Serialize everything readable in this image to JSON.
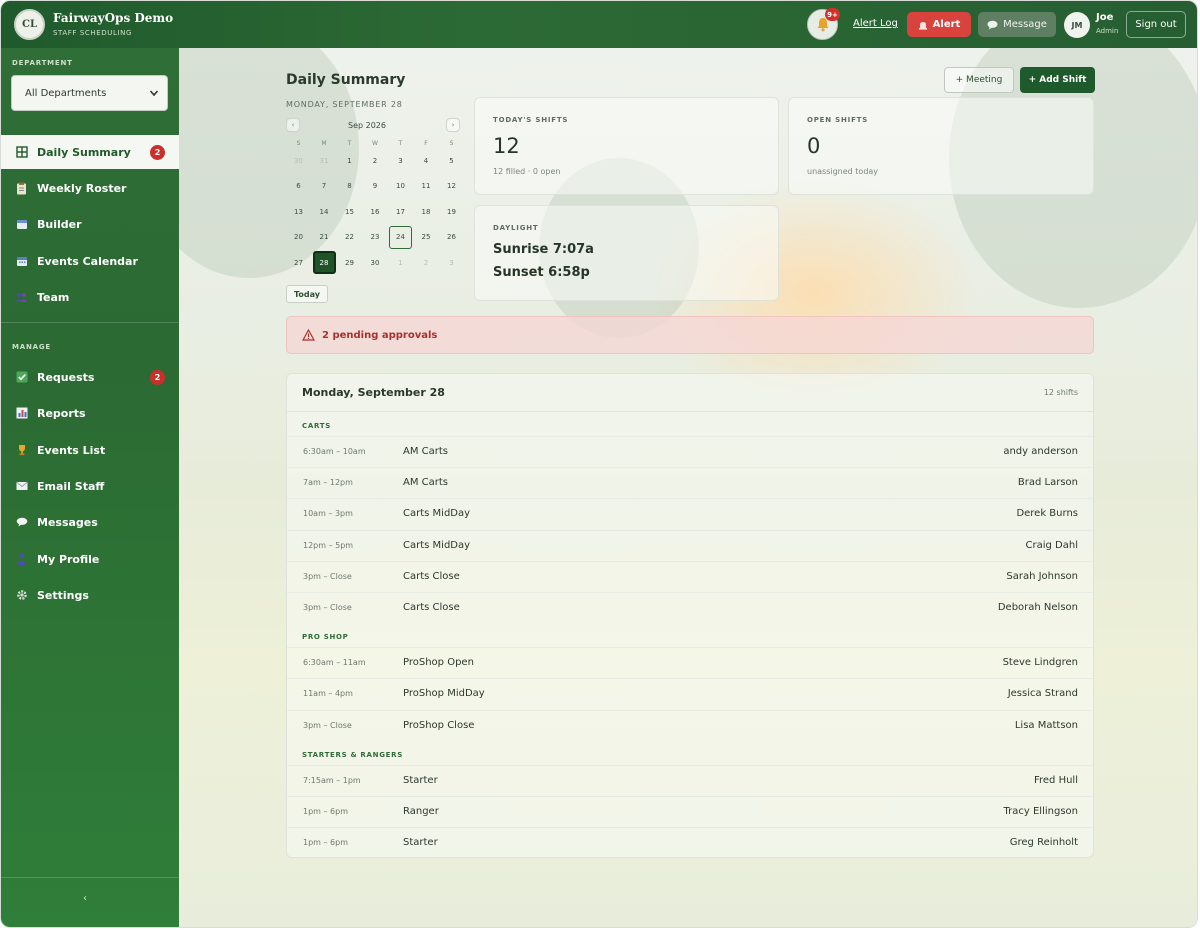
{
  "header": {
    "logo_initials": "CL",
    "app_name": "FairwayOps Demo",
    "app_subtitle": "STAFF SCHEDULING",
    "notification_count": "9+",
    "alert_log_label": "Alert Log",
    "alert_label": "Alert",
    "message_label": "Message",
    "user_initials": "JM",
    "user_name": "Joe",
    "user_role": "Admin",
    "sign_out_label": "Sign out"
  },
  "sidebar": {
    "department_label": "DEPARTMENT",
    "department_value": "All Departments",
    "nav": [
      {
        "label": "Daily Summary",
        "icon": "grid-icon",
        "badge": "2",
        "active": true
      },
      {
        "label": "Weekly Roster",
        "icon": "clipboard-icon"
      },
      {
        "label": "Builder",
        "icon": "calendar-icon"
      },
      {
        "label": "Events Calendar",
        "icon": "calendar-grid-icon"
      },
      {
        "label": "Team",
        "icon": "people-icon"
      }
    ],
    "manage_label": "MANAGE",
    "manage": [
      {
        "label": "Requests",
        "icon": "checkbox-icon",
        "badge": "2"
      },
      {
        "label": "Reports",
        "icon": "bar-chart-icon"
      },
      {
        "label": "Events List",
        "icon": "trophy-icon"
      },
      {
        "label": "Email Staff",
        "icon": "envelope-icon"
      },
      {
        "label": "Messages",
        "icon": "speech-bubble-icon"
      },
      {
        "label": "My Profile",
        "icon": "person-icon"
      },
      {
        "label": "Settings",
        "icon": "gear-icon"
      }
    ],
    "collapse_glyph": "‹"
  },
  "main": {
    "title": "Daily Summary",
    "date_heading": "MONDAY, SEPTEMBER 28",
    "meeting_label": "+ Meeting",
    "add_shift_label": "+ Add Shift",
    "calendar": {
      "month_label": "Sep 2026",
      "prev_glyph": "‹",
      "next_glyph": "›",
      "dow": [
        "S",
        "M",
        "T",
        "W",
        "T",
        "F",
        "S"
      ],
      "weeks": [
        [
          "30",
          "31",
          "1",
          "2",
          "3",
          "4",
          "5"
        ],
        [
          "6",
          "7",
          "8",
          "9",
          "10",
          "11",
          "12"
        ],
        [
          "13",
          "14",
          "15",
          "16",
          "17",
          "18",
          "19"
        ],
        [
          "20",
          "21",
          "22",
          "23",
          "24",
          "25",
          "26"
        ],
        [
          "27",
          "28",
          "29",
          "30",
          "1",
          "2",
          "3"
        ]
      ],
      "today_label": "Today"
    },
    "cards": {
      "shifts_label": "TODAY'S SHIFTS",
      "shifts_value": "12",
      "shifts_sub": "12 filled · 0 open",
      "open_label": "OPEN SHIFTS",
      "open_value": "0",
      "open_sub": "unassigned today",
      "daylight_label": "DAYLIGHT",
      "sunrise": "Sunrise 7:07a",
      "sunset": "Sunset 6:58p"
    },
    "approvals_text": "2 pending approvals",
    "schedule": {
      "date": "Monday, September 28",
      "count": "12 shifts",
      "groups": [
        {
          "name": "CARTS",
          "rows": [
            {
              "time": "6:30am – 10am",
              "role": "AM Carts",
              "person": "andy anderson"
            },
            {
              "time": "7am – 12pm",
              "role": "AM Carts",
              "person": "Brad Larson"
            },
            {
              "time": "10am – 3pm",
              "role": "Carts MidDay",
              "person": "Derek Burns"
            },
            {
              "time": "12pm – 5pm",
              "role": "Carts MidDay",
              "person": "Craig Dahl"
            },
            {
              "time": "3pm – Close",
              "role": "Carts Close",
              "person": "Sarah Johnson"
            },
            {
              "time": "3pm – Close",
              "role": "Carts Close",
              "person": "Deborah Nelson"
            }
          ]
        },
        {
          "name": "PRO SHOP",
          "rows": [
            {
              "time": "6:30am – 11am",
              "role": "ProShop Open",
              "person": "Steve Lindgren"
            },
            {
              "time": "11am – 4pm",
              "role": "ProShop MidDay",
              "person": "Jessica Strand"
            },
            {
              "time": "3pm – Close",
              "role": "ProShop Close",
              "person": "Lisa Mattson"
            }
          ]
        },
        {
          "name": "STARTERS & RANGERS",
          "rows": [
            {
              "time": "7:15am – 1pm",
              "role": "Starter",
              "person": "Fred Hull"
            },
            {
              "time": "1pm – 6pm",
              "role": "Ranger",
              "person": "Tracy Ellingson"
            },
            {
              "time": "1pm – 6pm",
              "role": "Starter",
              "person": "Greg Reinholt"
            }
          ]
        }
      ]
    }
  },
  "colors": {
    "brand_green": "#1f5a2c",
    "sidebar_green": "#2e7536",
    "alert_red": "#d9433d",
    "badge_red": "#c9302c"
  }
}
